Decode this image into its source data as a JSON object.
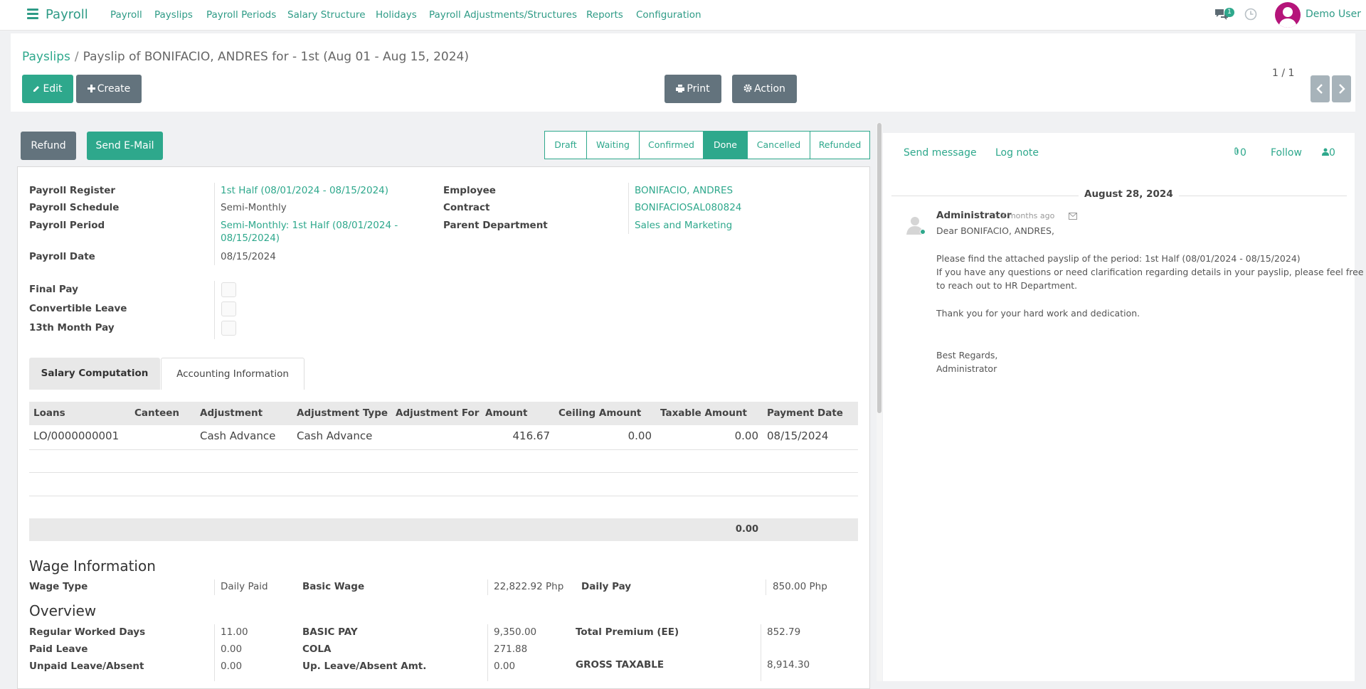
{
  "navbar": {
    "brand": "Payroll",
    "menu": [
      "Payroll",
      "Payslips",
      "Payroll Periods",
      "Salary Structure",
      "Holidays",
      "Payroll Adjustments/Structures",
      "Reports",
      "Configuration"
    ],
    "chat_badge": "1",
    "user_name": "Demo User"
  },
  "breadcrumb": {
    "parent": "Payslips",
    "current": "Payslip of BONIFACIO, ANDRES for - 1st (Aug 01 - Aug 15, 2024)"
  },
  "toolbar": {
    "edit": "Edit",
    "create": "Create",
    "print": "Print",
    "action": "Action",
    "pager": "1 / 1"
  },
  "statusbar": {
    "refund": "Refund",
    "send_email": "Send E-Mail",
    "stages": [
      "Draft",
      "Waiting",
      "Confirmed",
      "Done",
      "Cancelled",
      "Refunded"
    ],
    "active_stage": "Done"
  },
  "form": {
    "payroll_register_label": "Payroll Register",
    "payroll_register": "1st Half (08/01/2024 - 08/15/2024)",
    "payroll_schedule_label": "Payroll Schedule",
    "payroll_schedule": "Semi-Monthly",
    "payroll_period_label": "Payroll Period",
    "payroll_period_line1": "Semi-Monthly: 1st Half (08/01/2024 -",
    "payroll_period_line2": "08/15/2024)",
    "payroll_date_label": "Payroll Date",
    "payroll_date": "08/15/2024",
    "employee_label": "Employee",
    "employee": "BONIFACIO, ANDRES",
    "contract_label": "Contract",
    "contract": "BONIFACIOSAL080824",
    "parent_department_label": "Parent Department",
    "parent_department": "Sales and Marketing",
    "final_pay_label": "Final Pay",
    "convertible_leave_label": "Convertible Leave",
    "thirteenth_month_label": "13th Month Pay"
  },
  "tabs": {
    "salary_computation": "Salary Computation",
    "accounting_information": "Accounting Information"
  },
  "adjustments_table": {
    "headers": [
      "Loans",
      "Canteen",
      "Adjustment",
      "Adjustment Type",
      "Adjustment For",
      "Amount",
      "Ceiling Amount",
      "Taxable Amount",
      "Payment Date"
    ],
    "rows": [
      {
        "loans": "LO/0000000001",
        "canteen": "",
        "adjustment": "Cash Advance",
        "adjustment_type": "Cash Advance",
        "adjustment_for": "",
        "amount": "416.67",
        "ceiling_amount": "0.00",
        "taxable_amount": "0.00",
        "payment_date": "08/15/2024"
      }
    ],
    "total": "0.00"
  },
  "wage": {
    "title": "Wage Information",
    "wage_type_label": "Wage Type",
    "wage_type": "Daily Paid",
    "basic_wage_label": "Basic Wage",
    "basic_wage": "22,822.92 Php",
    "daily_pay_label": "Daily Pay",
    "daily_pay": "850.00 Php"
  },
  "overview": {
    "title": "Overview",
    "regular_worked_days_label": "Regular Worked Days",
    "regular_worked_days": "11.00",
    "paid_leave_label": "Paid Leave",
    "paid_leave": "0.00",
    "unpaid_leave_label": "Unpaid Leave/Absent",
    "unpaid_leave": "0.00",
    "basic_pay_label": "BASIC PAY",
    "basic_pay": "9,350.00",
    "cola_label": "COLA",
    "cola": "271.88",
    "up_leave_amt_label": "Up. Leave/Absent Amt.",
    "up_leave_amt": "0.00",
    "total_premium_label": "Total Premium (EE)",
    "total_premium": "852.79",
    "gross_taxable_label": "GROSS TAXABLE",
    "gross_taxable": "8,914.30"
  },
  "chatter": {
    "send_message": "Send message",
    "log_note": "Log note",
    "attachments": "0",
    "follow": "Follow",
    "followers": "0",
    "date": "August 28, 2024",
    "author": "Administrator",
    "time": "- 2 months ago",
    "lines": [
      "Dear BONIFACIO, ANDRES,",
      "",
      "Please find the attached payslip of the period: 1st Half (08/01/2024 - 08/15/2024)",
      "If you have any questions or need clarification regarding details in your payslip, please feel free",
      "to reach out to HR Department.",
      "",
      "Thank you for your hard work and dedication.",
      "",
      "",
      "Best Regards,",
      "Administrator"
    ]
  },
  "colors": {
    "accent": "#2ea88c",
    "slate": "#63737d",
    "avatar": "#b5147a"
  }
}
